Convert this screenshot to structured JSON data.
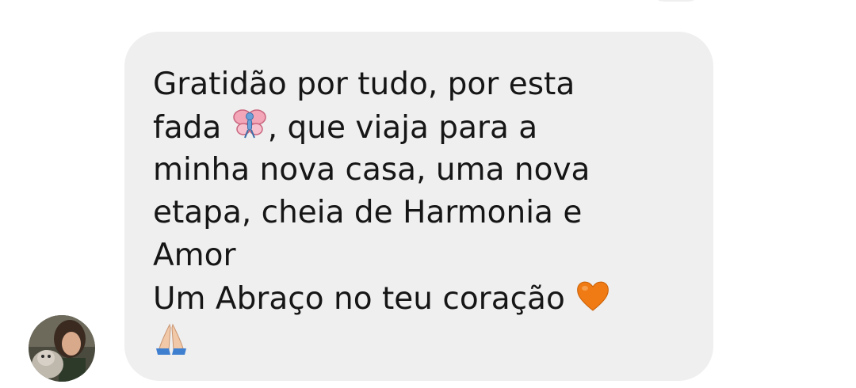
{
  "conversation": {
    "message": {
      "lines": [
        "Gratidão por tudo, por esta",
        "fada",
        ", que viaja para a",
        "minha nova casa, uma nova",
        "etapa, cheia de Harmonia e",
        "Amor",
        "Um Abraço no teu coração"
      ],
      "emojis": [
        "fairy-icon",
        "orange-heart-icon",
        "folded-hands-icon"
      ]
    },
    "colors": {
      "bubble": "#efefef",
      "text": "#161616",
      "background": "#ffffff"
    }
  }
}
